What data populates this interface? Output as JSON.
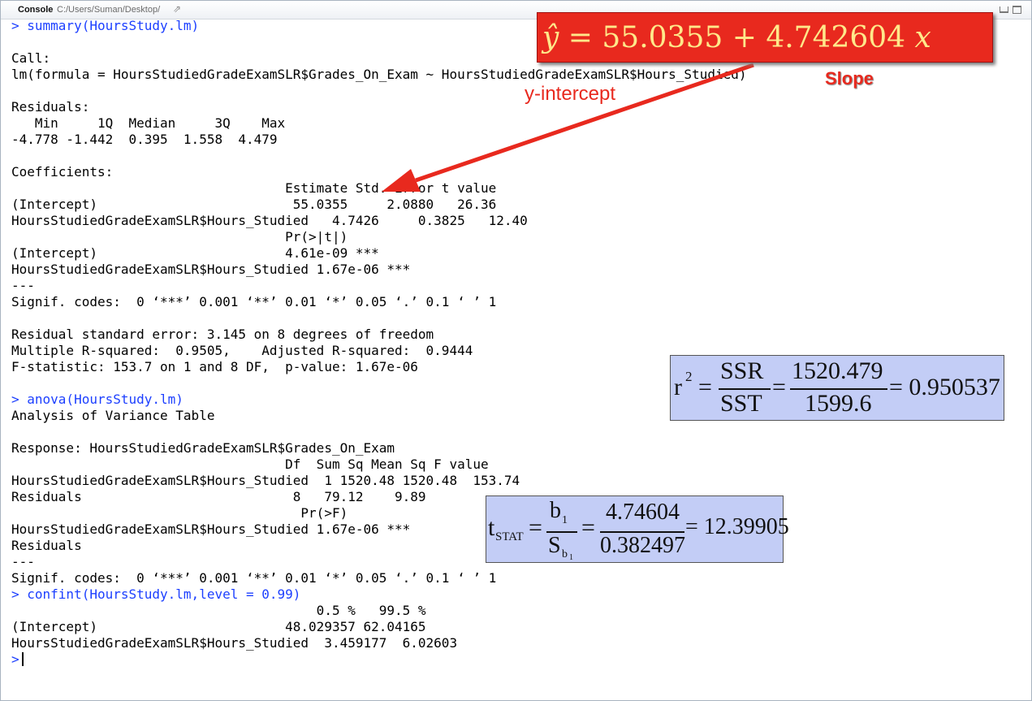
{
  "titlebar": {
    "title": "Console",
    "path": "C:/Users/Suman/Desktop/",
    "arrow_icon": "⇗"
  },
  "console": {
    "lines": [
      "> summary(HoursStudy.lm)",
      "",
      "Call:",
      "lm(formula = HoursStudiedGradeExamSLR$Grades_On_Exam ~ HoursStudiedGradeExamSLR$Hours_Studied)",
      "",
      "Residuals:",
      "   Min     1Q  Median     3Q    Max ",
      "-4.778 -1.442  0.395  1.558  4.479 ",
      "",
      "Coefficients:",
      "                                   Estimate Std. Error t value",
      "(Intercept)                         55.0355     2.0880   26.36",
      "HoursStudiedGradeExamSLR$Hours_Studied   4.7426     0.3825   12.40",
      "                                   Pr(>|t|)    ",
      "(Intercept)                        4.61e-09 ***",
      "HoursStudiedGradeExamSLR$Hours_Studied 1.67e-06 ***",
      "---",
      "Signif. codes:  0 ‘***’ 0.001 ‘**’ 0.01 ‘*’ 0.05 ‘.’ 0.1 ‘ ’ 1",
      "",
      "Residual standard error: 3.145 on 8 degrees of freedom",
      "Multiple R-squared:  0.9505,\tAdjusted R-squared:  0.9444 ",
      "F-statistic: 153.7 on 1 and 8 DF,  p-value: 1.67e-06",
      "",
      "> anova(HoursStudy.lm)",
      "Analysis of Variance Table",
      "",
      "Response: HoursStudiedGradeExamSLR$Grades_On_Exam",
      "                                   Df  Sum Sq Mean Sq F value",
      "HoursStudiedGradeExamSLR$Hours_Studied  1 1520.48 1520.48  153.74",
      "Residuals                           8   79.12    9.89        ",
      "                                     Pr(>F)    ",
      "HoursStudiedGradeExamSLR$Hours_Studied 1.67e-06 ***",
      "Residuals                                      ",
      "---",
      "Signif. codes:  0 ‘***’ 0.001 ‘**’ 0.01 ‘*’ 0.05 ‘.’ 0.1 ‘ ’ 1",
      "> confint(HoursStudy.lm,level = 0.99)",
      "                                       0.5 %   99.5 %",
      "(Intercept)                        48.029357 62.04165",
      "HoursStudiedGradeExamSLR$Hours_Studied  3.459177  6.02603",
      ">"
    ],
    "command_lines": [
      0,
      23,
      35,
      39
    ]
  },
  "annotations": {
    "equation": {
      "yhat": "ŷ",
      "rest": " = 55.0355 + 4.742604 ",
      "x": "x"
    },
    "slope_label": "Slope",
    "yintercept_label": "y-intercept",
    "accent_color": "#e8291e",
    "r2": {
      "lhs": "r",
      "sup": "2",
      "eq1": "=",
      "num1": "SSR",
      "den1": "SST",
      "eq2": "=",
      "num2": "1520.479",
      "den2": "1599.6",
      "result": "= 0.950537"
    },
    "tstat": {
      "lhs": "t",
      "sub": "STAT",
      "eq1": "=",
      "num1": "b",
      "num1_sub": "1",
      "den1": "S",
      "den1_sub": "b",
      "den1_subsub": "1",
      "eq2": "=",
      "num2": "4.74604",
      "den2": "0.382497",
      "result": "= 12.39905"
    },
    "formula_box_color": "#c3cdf6"
  }
}
